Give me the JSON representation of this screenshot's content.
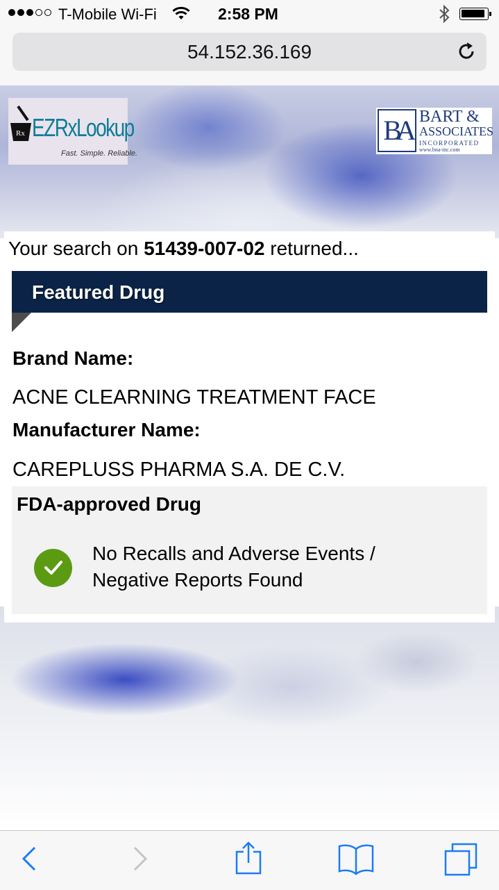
{
  "status_bar": {
    "carrier": "T-Mobile Wi-Fi",
    "time": "2:58 PM"
  },
  "browser": {
    "url": "54.152.36.169"
  },
  "logos": {
    "ezrx_main": "EZRxLookup",
    "ezrx_tagline": "Fast. Simple. Reliable.",
    "bart_line1": "BART &",
    "bart_line2": "ASSOCIATES",
    "bart_line3": "INCORPORATED",
    "bart_line4": "www.bna-inc.com",
    "bart_monogram": "BA"
  },
  "result": {
    "prefix": "Your search on ",
    "ndc": "51439-007-02",
    "suffix": " returned...",
    "featured_title": "Featured Drug",
    "brand_label": "Brand Name:",
    "brand_value": "ACNE CLEARNING TREATMENT FACE",
    "manufacturer_label": "Manufacturer Name:",
    "manufacturer_value": "CAREPLUSS PHARMA S.A. DE C.V.",
    "fda_title": "FDA-approved Drug",
    "fda_message": "No Recalls and Adverse Events / Negative Reports Found"
  },
  "colors": {
    "banner": "#0a2347",
    "check": "#5b9b12",
    "ios_blue": "#1a7cf5"
  },
  "toolbar": {
    "icons": [
      "back-icon",
      "forward-icon",
      "share-icon",
      "bookmarks-icon",
      "tabs-icon"
    ]
  }
}
